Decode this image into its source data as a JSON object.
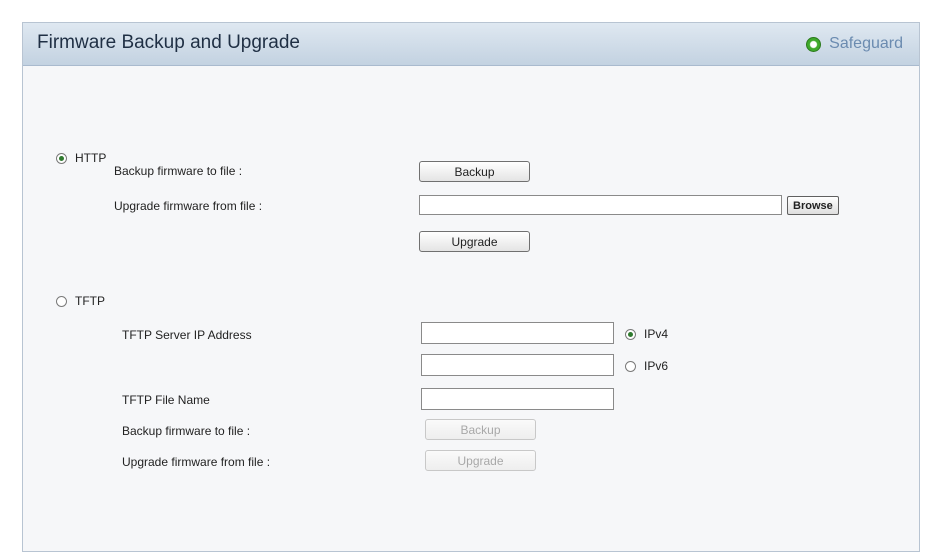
{
  "header": {
    "title": "Firmware Backup and Upgrade",
    "safeguard_label": "Safeguard"
  },
  "http": {
    "option_label": "HTTP",
    "backup_label": "Backup firmware to file :",
    "backup_button": "Backup",
    "upgrade_label": "Upgrade firmware from file :",
    "file_value": "",
    "browse_button": "Browse",
    "upgrade_button": "Upgrade"
  },
  "tftp": {
    "option_label": "TFTP",
    "server_ip_label": "TFTP Server IP Address",
    "ipv4_value": "",
    "ipv4_label": "IPv4",
    "ipv6_value": "",
    "ipv6_label": "IPv6",
    "file_name_label": "TFTP File Name",
    "file_name_value": "",
    "backup_label": "Backup firmware to file :",
    "backup_button": "Backup",
    "upgrade_label": "Upgrade firmware from file :",
    "upgrade_button": "Upgrade"
  },
  "colors": {
    "header_gradient_top": "#dfe8f1",
    "header_gradient_bottom": "#c3d2e1",
    "safeguard_indicator": "#3fa92b",
    "safeguard_text": "#6b8bb0"
  }
}
